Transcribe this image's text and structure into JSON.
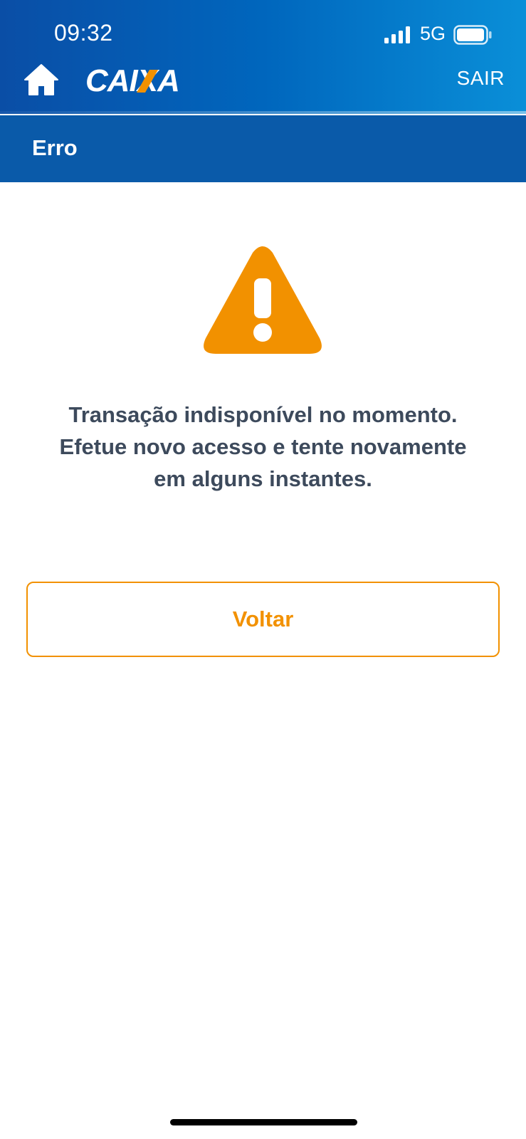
{
  "status_bar": {
    "time": "09:32",
    "network": "5G",
    "signal_icon": "signal-bars-icon",
    "battery_icon": "battery-icon"
  },
  "header": {
    "home_icon": "home-icon",
    "brand": "CAIXA",
    "logout_label": "SAIR",
    "gradient_start": "#0a4ea6",
    "gradient_end": "#0a8fd8"
  },
  "title_bar": {
    "title": "Erro",
    "background": "#0a5aa9"
  },
  "error": {
    "icon": "warning-icon",
    "icon_color": "#f29100",
    "lines": [
      "Transação indisponível no momento.",
      "Efetue novo acesso e tente novamente",
      "em alguns instantes."
    ]
  },
  "actions": {
    "back_label": "Voltar",
    "accent": "#f29100"
  }
}
